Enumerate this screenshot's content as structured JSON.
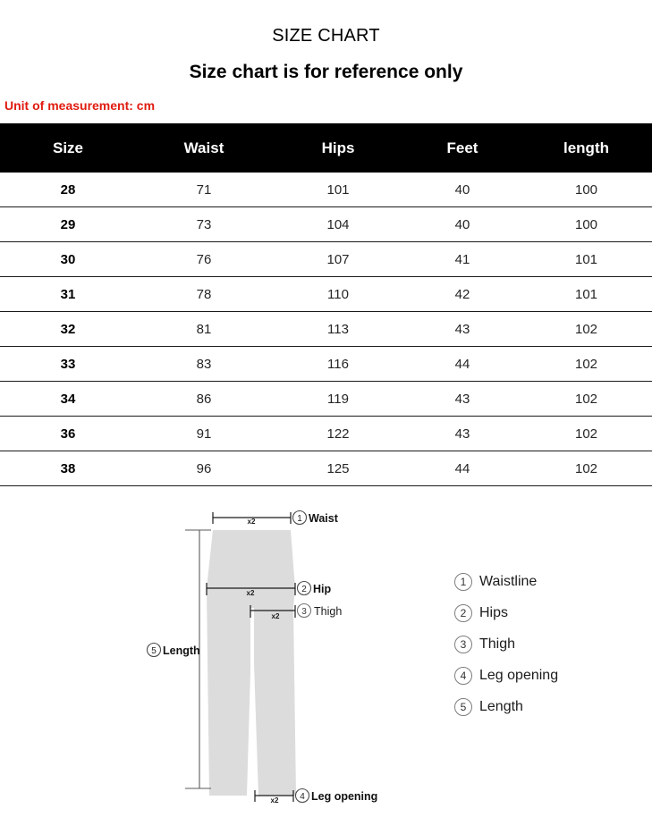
{
  "header": {
    "title": "SIZE CHART",
    "subtitle": "Size chart is for reference only",
    "unit_note": "Unit of measurement: cm",
    "unit_note_color": "#e01b10"
  },
  "chart_data": {
    "type": "table",
    "title": "SIZE CHART",
    "columns": [
      "Size",
      "Waist",
      "Hips",
      "Feet",
      "length"
    ],
    "rows": [
      [
        "28",
        "71",
        "101",
        "40",
        "100"
      ],
      [
        "29",
        "73",
        "104",
        "40",
        "100"
      ],
      [
        "30",
        "76",
        "107",
        "41",
        "101"
      ],
      [
        "31",
        "78",
        "110",
        "42",
        "101"
      ],
      [
        "32",
        "81",
        "113",
        "43",
        "102"
      ],
      [
        "33",
        "83",
        "116",
        "44",
        "102"
      ],
      [
        "34",
        "86",
        "119",
        "43",
        "102"
      ],
      [
        "36",
        "91",
        "122",
        "43",
        "102"
      ],
      [
        "38",
        "96",
        "125",
        "44",
        "102"
      ]
    ],
    "units": "cm",
    "header_background": "#000000",
    "header_text_color": "#ffffff"
  },
  "diagram": {
    "garment": "trousers",
    "fill_color": "#dcdcdc",
    "callouts": {
      "waist": {
        "num": "1",
        "label": "Waist",
        "multiplier": "x2"
      },
      "hip": {
        "num": "2",
        "label": "Hip",
        "multiplier": "x2"
      },
      "thigh": {
        "num": "3",
        "label": "Thigh",
        "multiplier": "x2"
      },
      "leg_opening": {
        "num": "4",
        "label": "Leg opening",
        "multiplier": "x2"
      },
      "length": {
        "num": "5",
        "label": "Length"
      }
    }
  },
  "legend": {
    "items": [
      {
        "num": "1",
        "label": "Waistline"
      },
      {
        "num": "2",
        "label": "Hips"
      },
      {
        "num": "3",
        "label": "Thigh"
      },
      {
        "num": "4",
        "label": "Leg opening"
      },
      {
        "num": "5",
        "label": "Length"
      }
    ]
  }
}
